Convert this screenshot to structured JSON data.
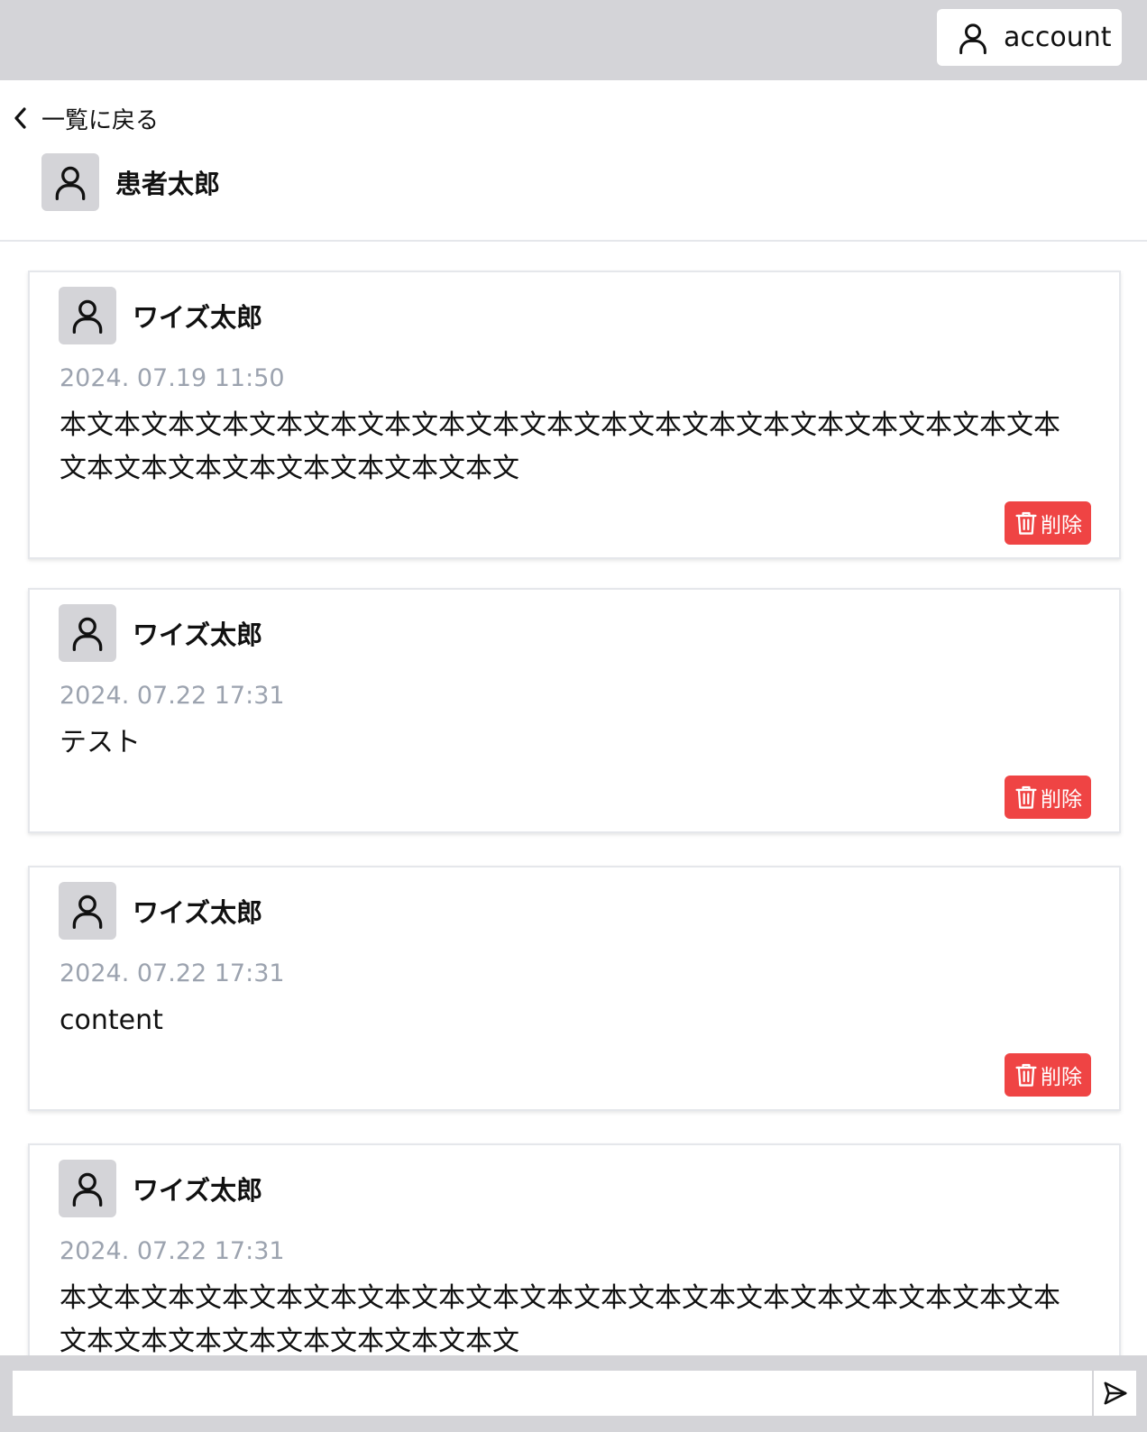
{
  "header": {
    "account_label": "account"
  },
  "nav": {
    "back_label": "一覧に戻る"
  },
  "patient": {
    "name": "患者太郎"
  },
  "posts": [
    {
      "author": "ワイズ太郎",
      "date": "2024. 07.19 11:50",
      "body": "本文本文本文本文本文本文本文本文本文本文本文本文本文本文本文本文本文本文本文本文本文本文本文本文本文本文本文",
      "delete_label": "削除"
    },
    {
      "author": "ワイズ太郎",
      "date": "2024. 07.22 17:31",
      "body": "テスト",
      "delete_label": "削除"
    },
    {
      "author": "ワイズ太郎",
      "date": "2024. 07.22 17:31",
      "body": "content",
      "delete_label": "削除"
    },
    {
      "author": "ワイズ太郎",
      "date": "2024. 07.22 17:31",
      "body": "本文本文本文本文本文本文本文本文本文本文本文本文本文本文本文本文本文本文本文本文本文本文本文本文本文本文本文",
      "delete_label": "削除"
    }
  ],
  "composer": {
    "value": "",
    "placeholder": ""
  },
  "icons": {
    "account": "user-icon",
    "back": "chevron-left-icon",
    "avatar": "user-icon",
    "delete": "trash-icon",
    "send": "send-icon"
  },
  "colors": {
    "bar": "#d4d4d8",
    "delete": "#ef4444",
    "date": "#9ca3af"
  }
}
